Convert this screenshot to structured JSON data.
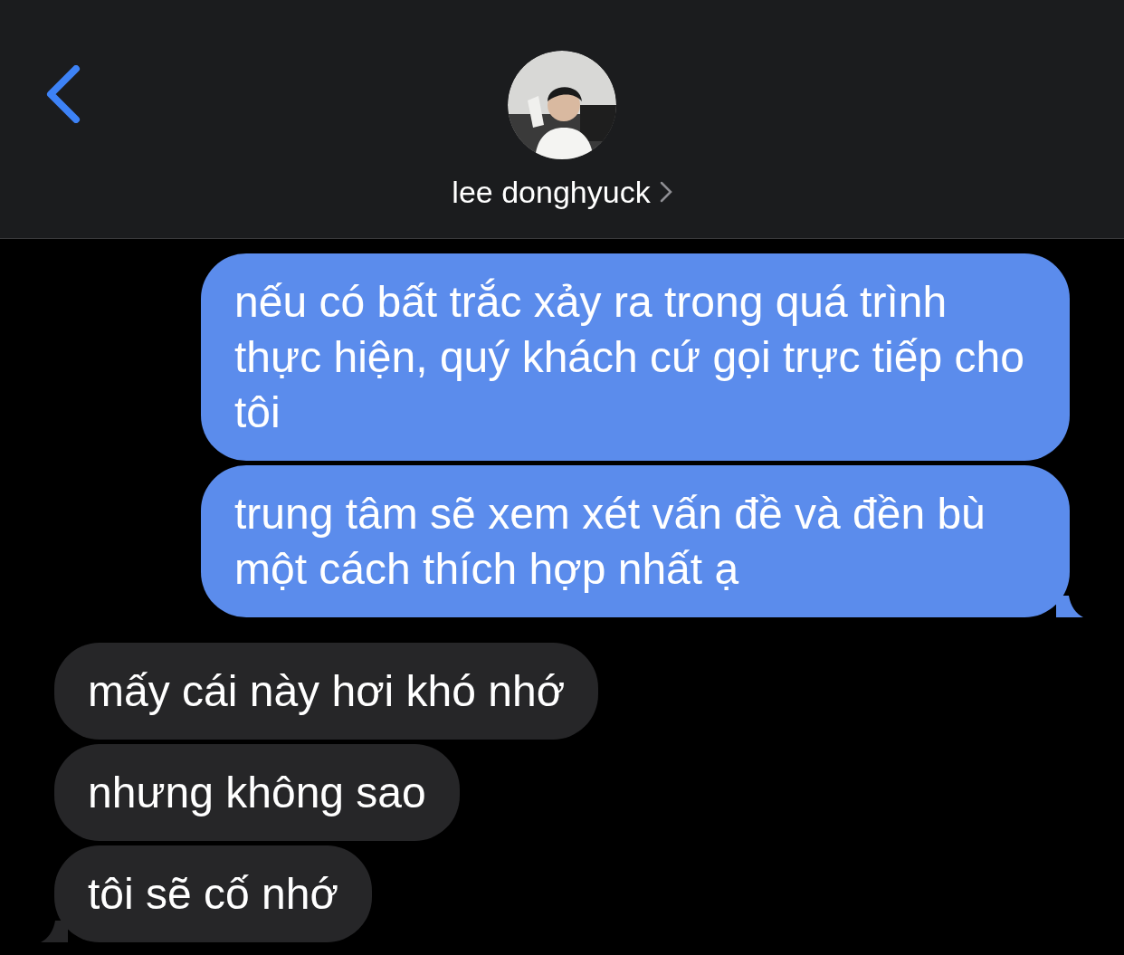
{
  "header": {
    "contact_name": "lee donghyuck"
  },
  "messages": [
    {
      "kind": "sent",
      "text": "nếu có bất trắc xảy ra trong quá trình thực hiện, quý khách cứ gọi trực tiếp cho tôi",
      "tail": false
    },
    {
      "kind": "sent",
      "text": "trung tâm sẽ xem xét vấn đề và đền bù một cách thích hợp nhất ạ",
      "tail": true
    },
    {
      "kind": "received",
      "text": "mấy cái này hơi khó nhớ",
      "tail": false
    },
    {
      "kind": "received",
      "text": "nhưng không sao",
      "tail": false
    },
    {
      "kind": "received",
      "text": "tôi sẽ cố nhớ",
      "tail": true
    }
  ]
}
